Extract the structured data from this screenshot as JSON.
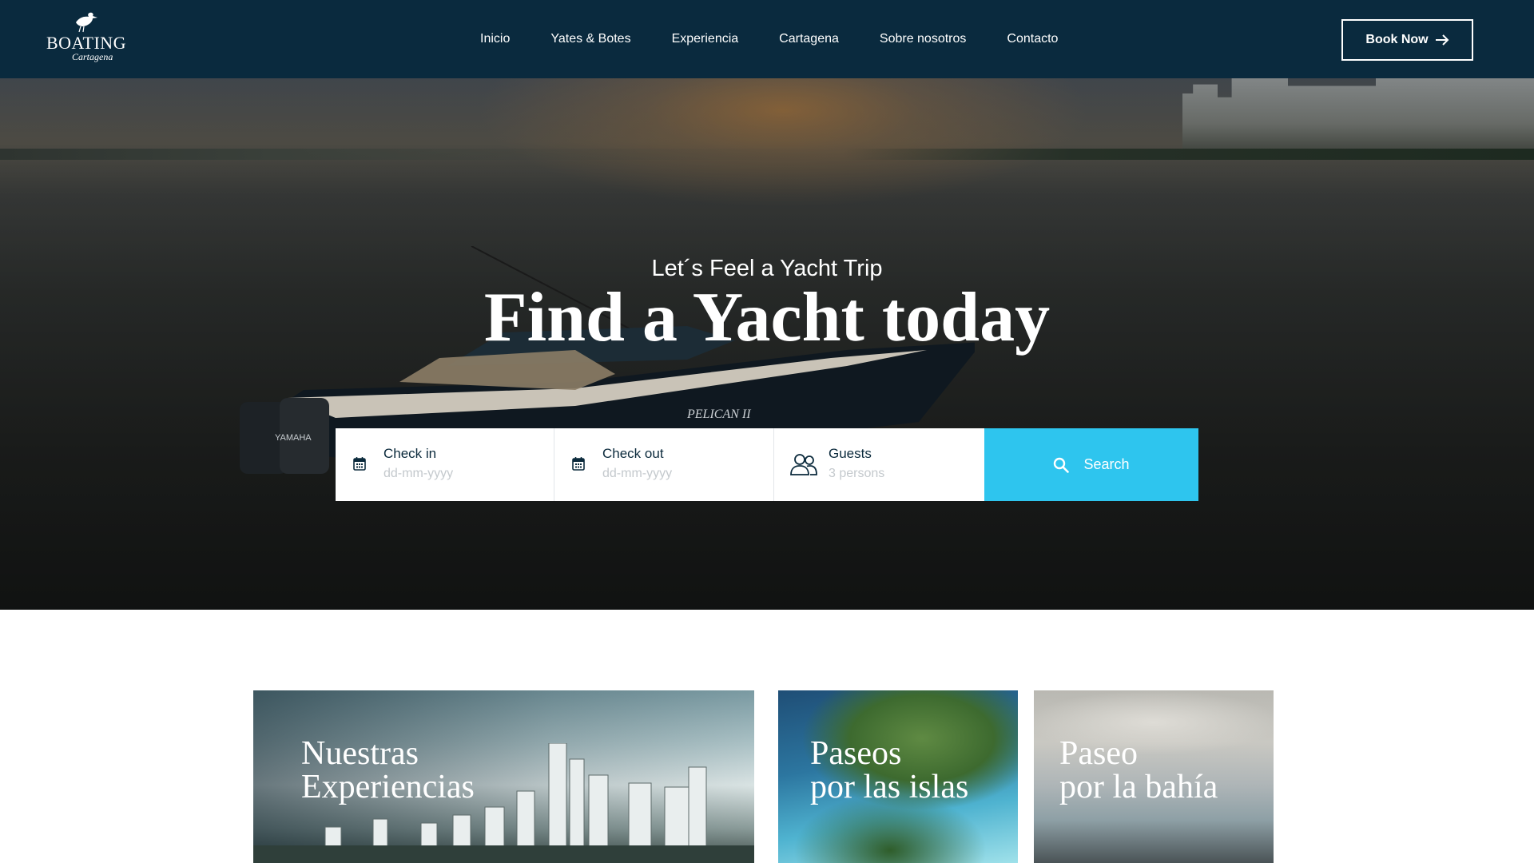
{
  "brand": {
    "name": "BOATING",
    "subtitle": "Cartagena"
  },
  "nav": {
    "items": [
      {
        "label": "Inicio"
      },
      {
        "label": "Yates & Botes"
      },
      {
        "label": "Experiencia"
      },
      {
        "label": "Cartagena"
      },
      {
        "label": "Sobre nosotros"
      },
      {
        "label": "Contacto"
      }
    ],
    "book_label": "Book Now"
  },
  "hero": {
    "subtitle": "Let´s Feel a Yacht Trip",
    "title": "Find a Yacht today",
    "boat_name": "PELICAN II",
    "engine_brand": "YAMAHA"
  },
  "search": {
    "checkin": {
      "label": "Check in",
      "placeholder": "dd-mm-yyyy"
    },
    "checkout": {
      "label": "Check out",
      "placeholder": "dd-mm-yyyy"
    },
    "guests": {
      "label": "Guests",
      "placeholder": "3 persons"
    },
    "button_label": "Search",
    "accent_color": "#2ec5ee"
  },
  "cards": [
    {
      "title": "Nuestras\nExperiencias"
    },
    {
      "title": "Paseos\npor las islas"
    },
    {
      "title": "Paseo\npor la bahía"
    }
  ],
  "colors": {
    "header_bg": "#0a2a3e",
    "accent": "#2ec5ee",
    "text_dark": "#0b2a3c"
  },
  "icons": {
    "logo": "pelican-icon",
    "book_arrow": "arrow-right-icon",
    "checkin": "calendar-icon",
    "checkout": "calendar-icon",
    "guests": "people-icon",
    "search": "search-icon"
  }
}
